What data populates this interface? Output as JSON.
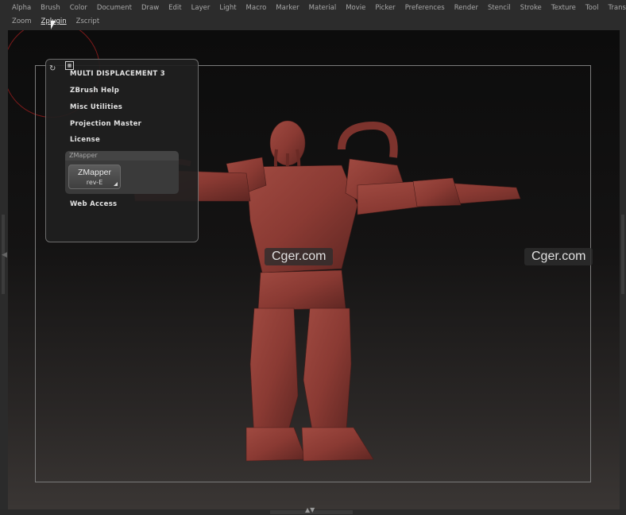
{
  "menu_row1": [
    "Alpha",
    "Brush",
    "Color",
    "Document",
    "Draw",
    "Edit",
    "Layer",
    "Light",
    "Macro",
    "Marker",
    "Material",
    "Movie",
    "Picker",
    "Preferences",
    "Render",
    "Stencil",
    "Stroke",
    "Texture",
    "Tool",
    "Transform"
  ],
  "menu_row2": [
    "Zoom",
    "Zplugin",
    "Zscript"
  ],
  "active_menu": "Zplugin",
  "zplugin_menu": {
    "items": [
      "MULTI DISPLACEMENT 3",
      "ZBrush Help",
      "Misc Utilities",
      "Projection Master",
      "License"
    ],
    "zmapper_section": {
      "header": "ZMapper",
      "button_title": "ZMapper",
      "button_sub": "rev-E"
    },
    "last_item": "Web Access"
  },
  "watermarks": [
    "Cger.com",
    "Cger.com"
  ],
  "colors": {
    "background": "#2b2b2b",
    "viewport_top": "#0c0c0c",
    "model": "#8a3a33"
  },
  "icons": [
    "refresh-icon",
    "grid-icon",
    "cursor-arrow-icon"
  ]
}
